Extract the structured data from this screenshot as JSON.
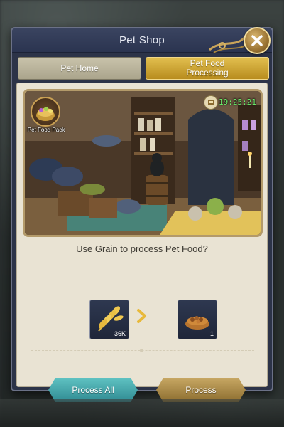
{
  "window": {
    "title": "Pet Shop"
  },
  "tabs": [
    {
      "label": "Pet Home",
      "active": false
    },
    {
      "label": "Pet Food Processing",
      "active": true
    }
  ],
  "scene": {
    "pack_label": "Pet Food Pack",
    "timer": "19:25:21"
  },
  "prompt": "Use Grain to process Pet Food?",
  "conversion": {
    "input": {
      "icon": "grain-icon",
      "quantity": "36K"
    },
    "output": {
      "icon": "pet-food-bowl-icon",
      "quantity": "1"
    }
  },
  "buttons": {
    "process_all": "Process All",
    "process": "Process"
  },
  "colors": {
    "panel": "#2c3348",
    "content_bg": "#e9e3d3",
    "tab_active": "#d4ad3a",
    "tab_inactive": "#bcb69d",
    "button_teal": "#3fa3aa",
    "button_gold": "#a88a45",
    "timer_green": "#6cf06c"
  }
}
